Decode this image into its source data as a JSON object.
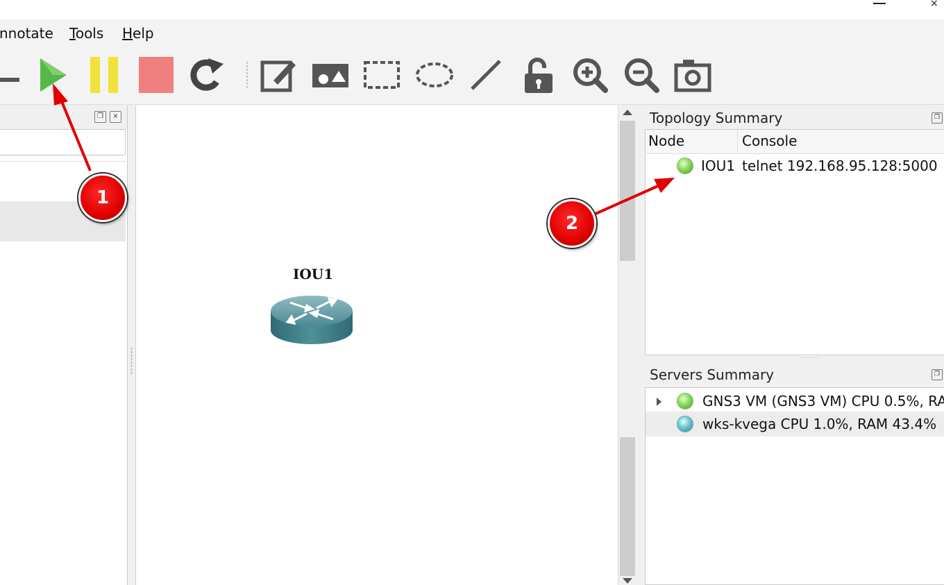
{
  "menubar": {
    "items": [
      {
        "label": "nnotate",
        "mnemonic": ""
      },
      {
        "label": "ools",
        "mnemonic": "T"
      },
      {
        "label": "elp",
        "mnemonic": "H"
      }
    ]
  },
  "toolbar": {
    "buttons": [
      {
        "icon": "start-icon",
        "color": "#56b84a"
      },
      {
        "icon": "pause-icon",
        "color": "#f0e23a"
      },
      {
        "icon": "stop-icon",
        "color": "#f08080"
      },
      {
        "icon": "reload-icon",
        "color": "#444444"
      },
      {
        "icon": "add-note-icon"
      },
      {
        "icon": "insert-picture-icon"
      },
      {
        "icon": "draw-rectangle-icon"
      },
      {
        "icon": "draw-ellipse-icon"
      },
      {
        "icon": "draw-line-icon"
      },
      {
        "icon": "unlock-icon"
      },
      {
        "icon": "zoom-in-icon"
      },
      {
        "icon": "zoom-out-icon"
      },
      {
        "icon": "screenshot-icon"
      }
    ]
  },
  "canvas": {
    "node": {
      "label": "IOU1",
      "icon": "router-icon"
    }
  },
  "topology_summary": {
    "title": "Topology Summary",
    "columns": [
      "Node",
      "Console"
    ],
    "rows": [
      {
        "node": "IOU1",
        "console": "telnet 192.168.95.128:5000",
        "status_color": "#5cc63a"
      }
    ]
  },
  "servers_summary": {
    "title": "Servers Summary",
    "rows": [
      {
        "text": "GNS3 VM (GNS3 VM) CPU 0.5%, RA",
        "status_color": "#5cc63a",
        "expandable": true
      },
      {
        "text": "wks-kvega CPU 1.0%, RAM 43.4%",
        "status_color": "#3d9fb0",
        "expandable": false
      }
    ]
  },
  "callouts": [
    {
      "label": "1",
      "color": "#e00000"
    },
    {
      "label": "2",
      "color": "#e00000"
    }
  ]
}
